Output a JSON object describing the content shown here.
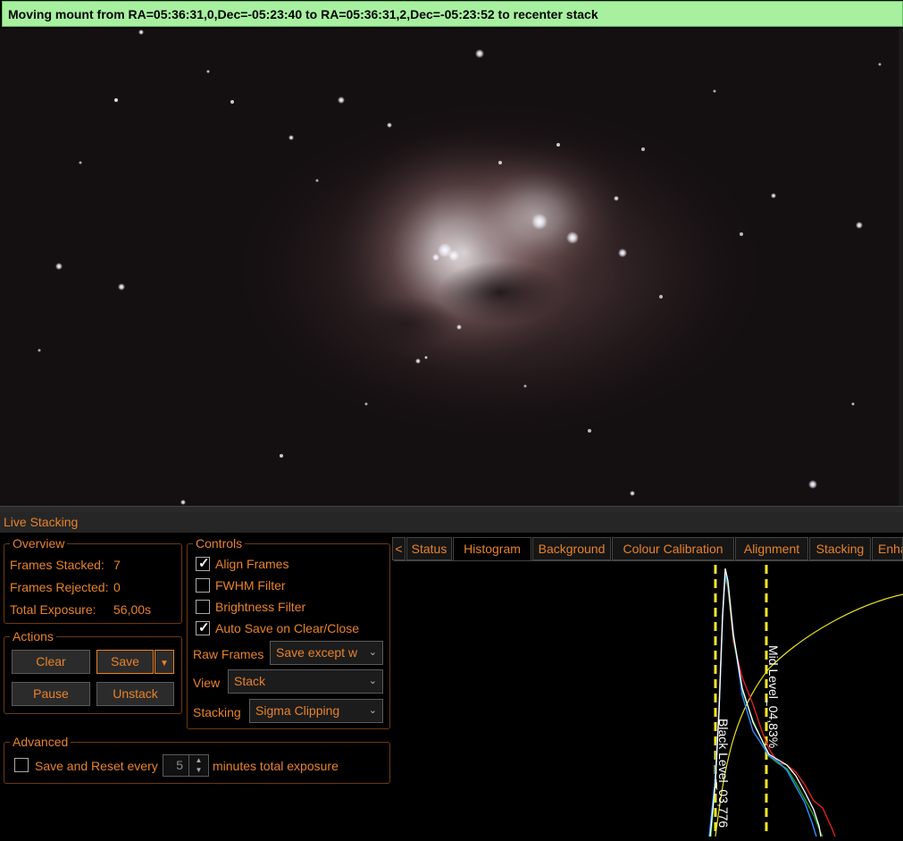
{
  "status_message": "Moving mount from RA=05:36:31,0,Dec=-05:23:40 to RA=05:36:31,2,Dec=-05:23:52 to recenter stack",
  "panel_title": "Live Stacking",
  "overview": {
    "label": "Overview",
    "frames_stacked_label": "Frames Stacked:",
    "frames_stacked": "7",
    "frames_rejected_label": "Frames Rejected:",
    "frames_rejected": "0",
    "total_exposure_label": "Total Exposure:",
    "total_exposure": "56,00s"
  },
  "actions": {
    "label": "Actions",
    "clear": "Clear",
    "save": "Save",
    "pause": "Pause",
    "unstack": "Unstack"
  },
  "controls": {
    "label": "Controls",
    "align_frames": "Align Frames",
    "align_frames_checked": true,
    "fwhm_filter": "FWHM Filter",
    "fwhm_filter_checked": false,
    "brightness_filter": "Brightness Filter",
    "brightness_filter_checked": false,
    "auto_save": "Auto Save on Clear/Close",
    "auto_save_checked": true,
    "raw_frames_label": "Raw Frames",
    "raw_frames_value": "Save except w",
    "view_label": "View",
    "view_value": "Stack",
    "stacking_label": "Stacking",
    "stacking_value": "Sigma Clipping"
  },
  "advanced": {
    "label": "Advanced",
    "save_reset_label": "Save and Reset every",
    "save_reset_checked": false,
    "minutes_value": "5",
    "minutes_suffix": "minutes total exposure"
  },
  "tabs": {
    "scroll_left": "<",
    "items": [
      "Status",
      "Histogram",
      "Background",
      "Colour Calibration",
      "Alignment",
      "Stacking",
      "Enha"
    ],
    "active": "Histogram"
  },
  "histogram": {
    "black_level_label": "Black Level_03,776",
    "mid_level_label": "Mid Level_04,83%",
    "series_colors": {
      "red": "#e02020",
      "green": "#20a020",
      "blue": "#2a90ff",
      "white": "#ffffff",
      "curve": "#e8e020",
      "markers": "#f5e52a"
    }
  }
}
